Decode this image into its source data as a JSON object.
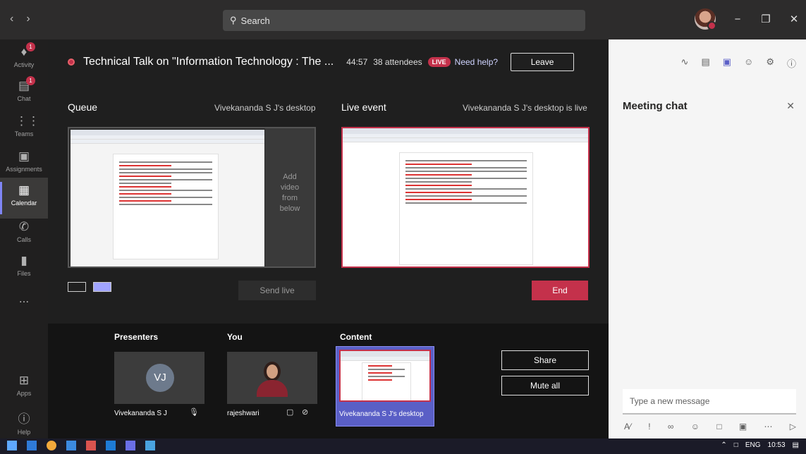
{
  "search": {
    "placeholder": "Search"
  },
  "window": {
    "minimize": "−",
    "maximize": "❐",
    "close": "✕",
    "back": "‹",
    "forward": "›"
  },
  "rail": [
    {
      "label": "Activity",
      "icon": "bell-icon",
      "badge": "1"
    },
    {
      "label": "Chat",
      "icon": "chat-icon",
      "badge": "1"
    },
    {
      "label": "Teams",
      "icon": "teams-icon"
    },
    {
      "label": "Assignments",
      "icon": "assignments-icon"
    },
    {
      "label": "Calendar",
      "icon": "calendar-icon",
      "active": true
    },
    {
      "label": "Calls",
      "icon": "phone-icon"
    },
    {
      "label": "Files",
      "icon": "files-icon"
    },
    {
      "label": "...",
      "icon": "more-icon"
    },
    {
      "label": "Apps",
      "icon": "apps-icon"
    },
    {
      "label": "Help",
      "icon": "help-icon"
    }
  ],
  "event": {
    "title": "Technical Talk on \"Information Technology : The ...",
    "timer": "44:57",
    "attendees": "38 attendees",
    "live_badge": "LIVE",
    "need_help": "Need help?",
    "leave": "Leave"
  },
  "queue": {
    "label": "Queue",
    "source": "Vivekananda S J's desktop",
    "add_video": [
      "Add",
      "video",
      "from",
      "below"
    ],
    "send_live": "Send live"
  },
  "live": {
    "label": "Live event",
    "status": "Vivekananda S J's desktop is live",
    "end": "End"
  },
  "strip": {
    "presenters_label": "Presenters",
    "you_label": "You",
    "content_label": "Content",
    "presenter_initials": "VJ",
    "presenter_name": "Vivekananda S J",
    "you_name": "rajeshwari",
    "content_name": "Vivekananda S J's desktop",
    "share": "Share",
    "mute_all": "Mute all"
  },
  "chat": {
    "title": "Meeting chat",
    "close": "✕",
    "placeholder": "Type a new message"
  },
  "taskbar": {
    "lang": "ENG",
    "time": "10:53"
  },
  "colors": {
    "accent": "#5b5fc7",
    "live_red": "#c4314b",
    "rail_bg": "#201f1f",
    "panel_bg": "#f5f5f5"
  }
}
